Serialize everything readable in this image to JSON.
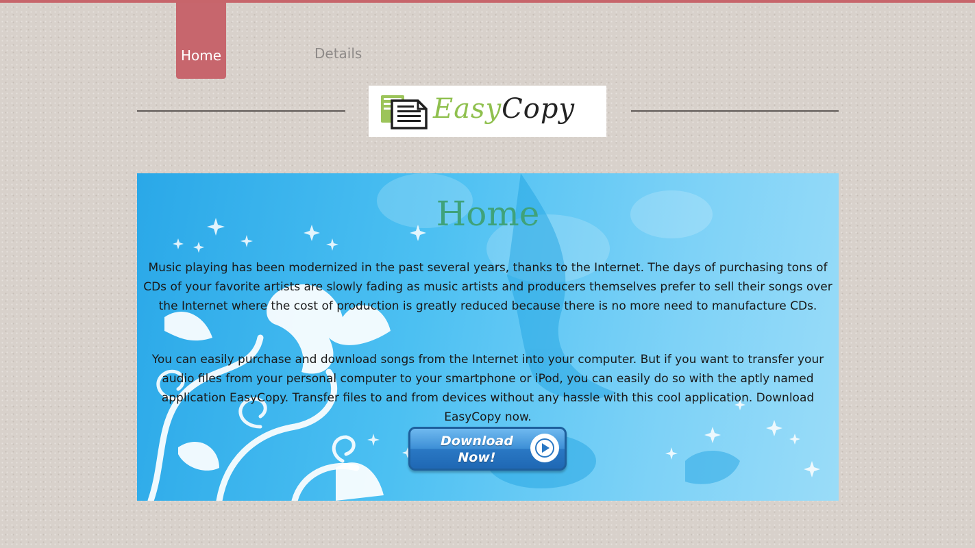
{
  "nav": {
    "home_label": "Home",
    "details_label": "Details"
  },
  "logo": {
    "easy": "Easy",
    "copy": "Copy"
  },
  "hero": {
    "title": "Home",
    "paragraph_1": "Music playing has been modernized in the past several years, thanks to the Internet. The days of purchasing tons of CDs of your favorite artists are slowly fading as music artists and producers themselves prefer to sell their songs over the Internet where the cost of production is greatly reduced because there is no more need to manufacture CDs.",
    "paragraph_2": "You can easily purchase and download songs from the Internet into your computer. But if you want to transfer your audio files from your personal computer to your smartphone or iPod, you can easily do so with the aptly named application EasyCopy. Transfer files to and from devices without any hassle with this cool application. Download EasyCopy now.",
    "download_line_1": "Download",
    "download_line_2": "Now!"
  },
  "colors": {
    "accent": "#c7666d",
    "logo_green": "#8fc04e",
    "title_green": "#3fa27a",
    "hero_blue": "#4cc0f2"
  },
  "icons": {
    "logo": "document-copy-icon",
    "download": "play-icon"
  }
}
